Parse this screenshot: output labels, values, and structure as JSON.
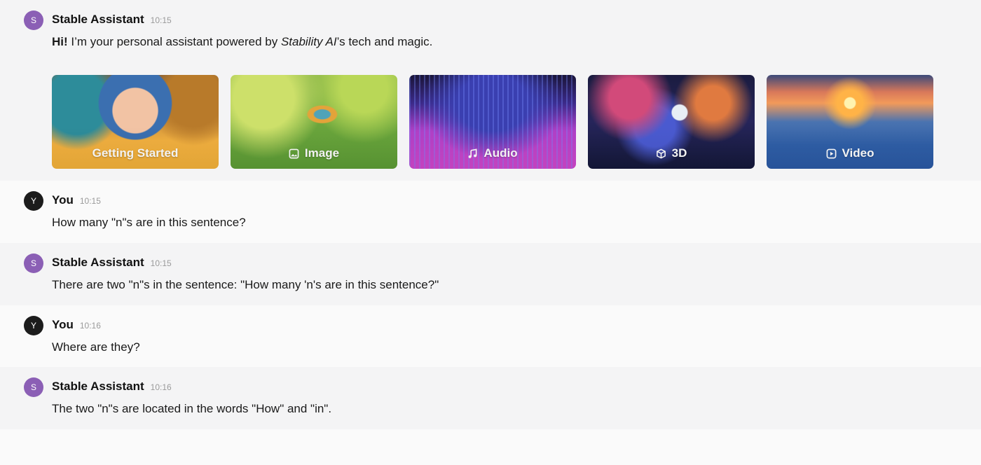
{
  "messages": {
    "intro": {
      "sender": "Stable Assistant",
      "avatar_initial": "S",
      "time": "10:15",
      "greeting_bold": "Hi!",
      "text_before": " I’m your personal assistant powered by ",
      "text_italic": "Stability AI",
      "text_after": "’s tech and magic.",
      "cards": [
        {
          "label": "Getting Started",
          "icon": "none"
        },
        {
          "label": "Image",
          "icon": "image-icon"
        },
        {
          "label": "Audio",
          "icon": "music-note-icon"
        },
        {
          "label": "3D",
          "icon": "cube-icon"
        },
        {
          "label": "Video",
          "icon": "play-square-icon"
        }
      ]
    },
    "m1": {
      "sender": "You",
      "avatar_initial": "Y",
      "time": "10:15",
      "text": "How many \"n\"s are in this sentence?"
    },
    "m2": {
      "sender": "Stable Assistant",
      "avatar_initial": "S",
      "time": "10:15",
      "text": "There are two \"n\"s in the sentence: \"How many 'n's are in this sentence?\""
    },
    "m3": {
      "sender": "You",
      "avatar_initial": "Y",
      "time": "10:16",
      "text": "Where are they?"
    },
    "m4": {
      "sender": "Stable Assistant",
      "avatar_initial": "S",
      "time": "10:16",
      "text": "The two \"n\"s are located in the words \"How\" and \"in\"."
    }
  },
  "colors": {
    "assistant_avatar": "#8b5fb5",
    "user_avatar": "#1c1c1c",
    "assistant_row_bg": "#f4f4f5",
    "user_row_bg": "#fafafa"
  }
}
